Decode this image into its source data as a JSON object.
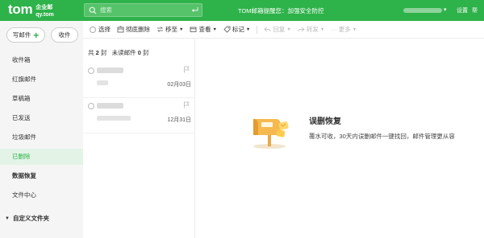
{
  "header": {
    "brand": "tom",
    "brand_sub_line1": "企业邮",
    "brand_sub_line2": "qy.tom",
    "search_placeholder": "搜索",
    "notice": "TOM邮箱提醒您：加强安全防控",
    "user_arrow": "▾",
    "settings": "设置",
    "help": "帮"
  },
  "sidebar": {
    "compose": "写邮件",
    "compose_plus": "+",
    "receive": "收件",
    "folders": [
      {
        "label": "收件箱",
        "active": false,
        "bold": false
      },
      {
        "label": "红旗邮件",
        "active": false,
        "bold": false
      },
      {
        "label": "草稿箱",
        "active": false,
        "bold": false
      },
      {
        "label": "已发送",
        "active": false,
        "bold": false
      },
      {
        "label": "垃圾邮件",
        "active": false,
        "bold": false
      },
      {
        "label": "已删除",
        "active": true,
        "bold": false
      },
      {
        "label": "数据恢复",
        "active": false,
        "bold": true
      },
      {
        "label": "文件中心",
        "active": false,
        "bold": false
      }
    ],
    "custom_folders": "自定义文件夹"
  },
  "toolbar": {
    "select": "选择",
    "delete_forever": "彻底删除",
    "move_to": "移至",
    "view": "查看",
    "tag": "标记",
    "reply": "回复",
    "forward": "转发",
    "more": "更多"
  },
  "maillist": {
    "total_prefix": "共",
    "total": "2",
    "total_unit": "封",
    "unread_prefix": "未读邮件",
    "unread": "0",
    "unread_unit": "封",
    "items": [
      {
        "date": "02月03日"
      },
      {
        "date": "12月31日"
      }
    ]
  },
  "empty_state": {
    "title": "误删恢复",
    "description": "覆水可收，30天内误删邮件一键找回，邮件管理更从容"
  },
  "colors": {
    "brand_green": "#2eb24a",
    "active_folder_bg": "#e3f4e6"
  }
}
